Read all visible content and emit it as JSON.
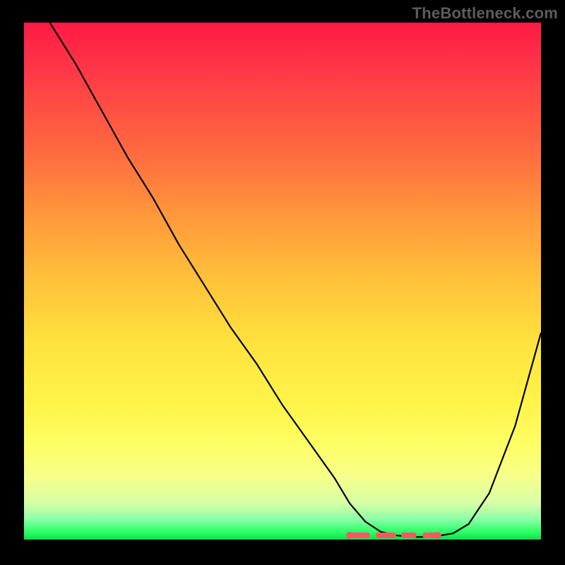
{
  "watermark": "TheBottleneck.com",
  "colors": {
    "curve": "#000000",
    "marker": "#f05a63"
  },
  "chart_data": {
    "type": "line",
    "title": "",
    "xlabel": "",
    "ylabel": "",
    "xlim": [
      0,
      100
    ],
    "ylim": [
      0,
      100
    ],
    "x": [
      5,
      10,
      15,
      20,
      25,
      30,
      35,
      40,
      45,
      50,
      55,
      60,
      63,
      66,
      69,
      72,
      75,
      78,
      80,
      83,
      86,
      90,
      95,
      100
    ],
    "values": [
      100,
      92,
      83,
      74,
      66,
      57,
      49,
      41,
      34,
      26,
      19,
      12,
      7,
      3.5,
      1.5,
      0.8,
      0.5,
      0.5,
      0.7,
      1.2,
      3,
      9,
      22,
      40
    ],
    "optimal_zone": {
      "x_segments": [
        [
          63,
          67
        ],
        [
          68,
          72
        ],
        [
          73,
          76
        ],
        [
          77,
          80
        ]
      ],
      "y": 0.8
    },
    "gradient_stops": [
      {
        "pct": 0,
        "hex": "#ff1a46"
      },
      {
        "pct": 25,
        "hex": "#ff6a3f"
      },
      {
        "pct": 50,
        "hex": "#ffc23a"
      },
      {
        "pct": 74,
        "hex": "#fff44a"
      },
      {
        "pct": 93,
        "hex": "#d6ffa6"
      },
      {
        "pct": 100,
        "hex": "#10e04a"
      }
    ]
  }
}
